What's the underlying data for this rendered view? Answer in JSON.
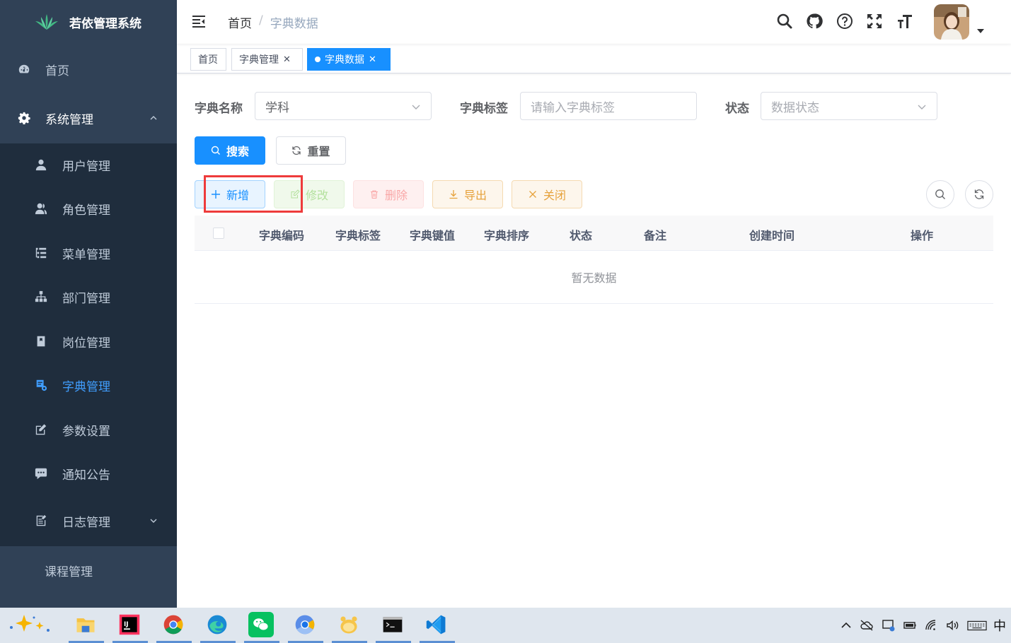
{
  "sidebar": {
    "title": "若依管理系统",
    "items": [
      {
        "label": "首页"
      },
      {
        "label": "系统管理"
      },
      {
        "label": "用户管理"
      },
      {
        "label": "角色管理"
      },
      {
        "label": "菜单管理"
      },
      {
        "label": "部门管理"
      },
      {
        "label": "岗位管理"
      },
      {
        "label": "字典管理"
      },
      {
        "label": "参数设置"
      },
      {
        "label": "通知公告"
      },
      {
        "label": "日志管理"
      },
      {
        "label": "课程管理"
      }
    ]
  },
  "breadcrumb": {
    "home": "首页",
    "sep": "/",
    "current": "字典数据"
  },
  "tags": [
    {
      "label": "首页"
    },
    {
      "label": "字典管理",
      "close": "✕"
    },
    {
      "label": "字典数据",
      "close": "✕"
    }
  ],
  "form": {
    "dict_name_label": "字典名称",
    "dict_name_value": "学科",
    "dict_label_label": "字典标签",
    "dict_label_placeholder": "请输入字典标签",
    "status_label": "状态",
    "status_placeholder": "数据状态"
  },
  "buttons": {
    "search": "搜索",
    "reset": "重置",
    "add": "新增",
    "edit": "修改",
    "delete": "删除",
    "export": "导出",
    "close": "关闭"
  },
  "table": {
    "headers": [
      "字典编码",
      "字典标签",
      "字典键值",
      "字典排序",
      "状态",
      "备注",
      "创建时间",
      "操作"
    ],
    "empty_text": "暂无数据"
  },
  "taskbar": {
    "ime": "中"
  },
  "colors": {
    "sidebar_bg": "#304156",
    "submenu_bg": "#1f2d3d",
    "primary": "#1890ff",
    "highlight": "#ee3b3b"
  }
}
